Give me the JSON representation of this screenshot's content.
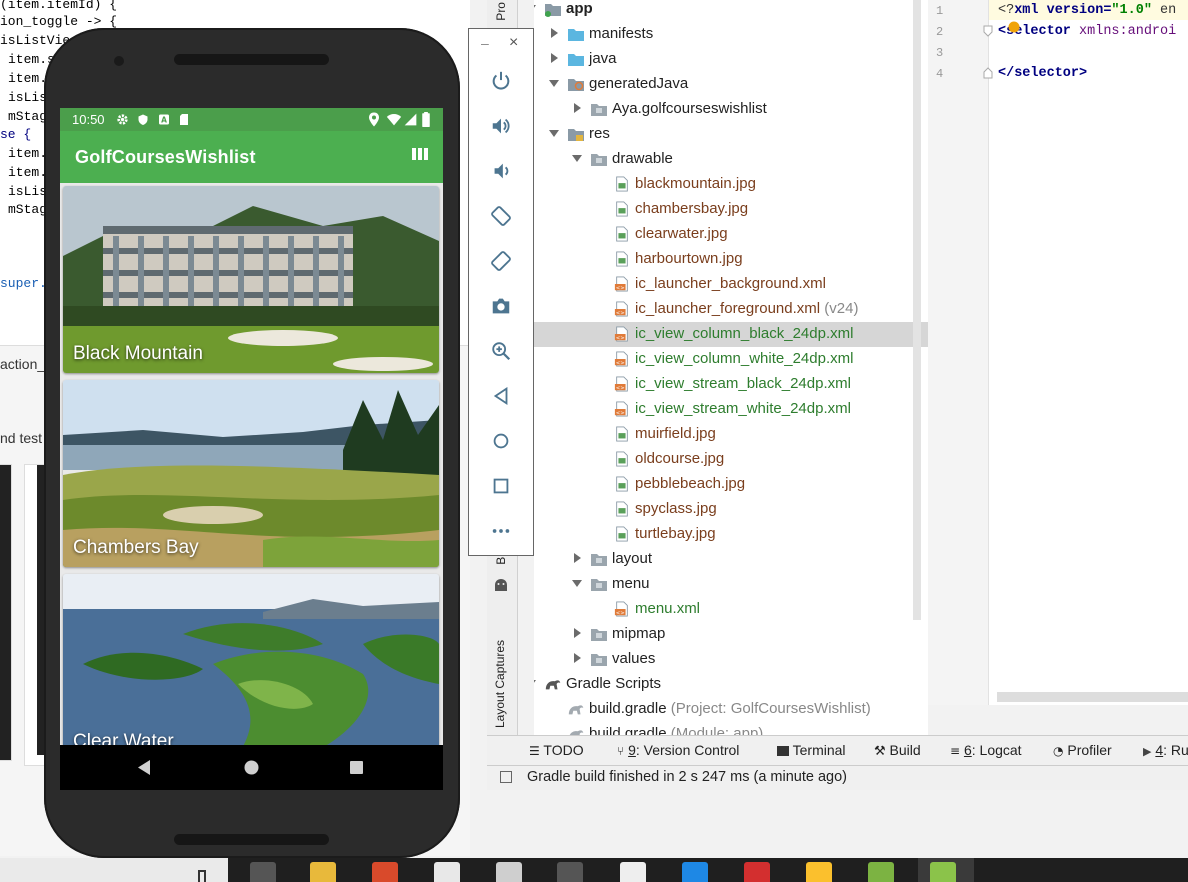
{
  "background_code": {
    "lines": [
      "(item.itemId) {",
      "ion_toggle -> {",
      "isListVie",
      "item.s",
      "item.s",
      "isLis",
      "mStag",
      "se {",
      "item.s",
      "item.s",
      "isLis",
      "mStag",
      "super.on"
    ],
    "lower_texts": [
      "action_",
      "nd test"
    ]
  },
  "emulator": {
    "status_time": "10:50",
    "app_title": "GolfCoursesWishlist",
    "view_toggle_icon": "view-column-icon",
    "courses": [
      {
        "name": "Black Mountain"
      },
      {
        "name": "Chambers Bay"
      },
      {
        "name": "Clear Water"
      }
    ],
    "nav": [
      "back-icon",
      "home-icon",
      "recents-icon"
    ]
  },
  "emulator_toolbar": {
    "minimize": "–",
    "close": "×",
    "buttons": [
      "power-icon",
      "volume-up-icon",
      "volume-down-icon",
      "rotate-left-icon",
      "rotate-right-icon",
      "camera-icon",
      "zoom-icon",
      "back-icon",
      "home-icon",
      "overview-icon",
      "more-icon"
    ]
  },
  "ide_side_strip": {
    "top_label": "Pro",
    "mid_label": "Bu",
    "bottom_label": "Layout Captures"
  },
  "project_tree": {
    "rows": [
      {
        "label": "app",
        "depth": 0,
        "expanded": true,
        "type": "module"
      },
      {
        "label": "manifests",
        "depth": 1,
        "expanded": false,
        "type": "folder"
      },
      {
        "label": "java",
        "depth": 1,
        "expanded": false,
        "type": "folder"
      },
      {
        "label": "generatedJava",
        "depth": 1,
        "expanded": true,
        "type": "folder-gen"
      },
      {
        "label": "Aya.golfcourseswishlist",
        "depth": 2,
        "expanded": false,
        "type": "package"
      },
      {
        "label": "res",
        "depth": 1,
        "expanded": true,
        "type": "folder-res"
      },
      {
        "label": "drawable",
        "depth": 2,
        "expanded": true,
        "type": "package"
      },
      {
        "label": "blackmountain.jpg",
        "depth": 3,
        "type": "image"
      },
      {
        "label": "chambersbay.jpg",
        "depth": 3,
        "type": "image"
      },
      {
        "label": "clearwater.jpg",
        "depth": 3,
        "type": "image"
      },
      {
        "label": "harbourtown.jpg",
        "depth": 3,
        "type": "image"
      },
      {
        "label": "ic_launcher_background.xml",
        "depth": 3,
        "type": "xml"
      },
      {
        "label": "ic_launcher_foreground.xml",
        "hint": "(v24)",
        "depth": 3,
        "type": "xml"
      },
      {
        "label": "ic_view_column_black_24dp.xml",
        "depth": 3,
        "type": "xml-new",
        "selected": true
      },
      {
        "label": "ic_view_column_white_24dp.xml",
        "depth": 3,
        "type": "xml-new"
      },
      {
        "label": "ic_view_stream_black_24dp.xml",
        "depth": 3,
        "type": "xml-new"
      },
      {
        "label": "ic_view_stream_white_24dp.xml",
        "depth": 3,
        "type": "xml-new"
      },
      {
        "label": "muirfield.jpg",
        "depth": 3,
        "type": "image"
      },
      {
        "label": "oldcourse.jpg",
        "depth": 3,
        "type": "image"
      },
      {
        "label": "pebblebeach.jpg",
        "depth": 3,
        "type": "image"
      },
      {
        "label": "spyclass.jpg",
        "depth": 3,
        "type": "image"
      },
      {
        "label": "turtlebay.jpg",
        "depth": 3,
        "type": "image"
      },
      {
        "label": "layout",
        "depth": 2,
        "expanded": false,
        "type": "package"
      },
      {
        "label": "menu",
        "depth": 2,
        "expanded": true,
        "type": "package"
      },
      {
        "label": "menu.xml",
        "depth": 3,
        "type": "xml-new"
      },
      {
        "label": "mipmap",
        "depth": 2,
        "expanded": false,
        "type": "package"
      },
      {
        "label": "values",
        "depth": 2,
        "expanded": false,
        "type": "package"
      },
      {
        "label": "Gradle Scripts",
        "depth": 0,
        "expanded": true,
        "type": "gradle"
      },
      {
        "label": "build.gradle",
        "hint": "(Project: GolfCoursesWishlist)",
        "depth": 1,
        "type": "gradle-file"
      },
      {
        "label": "build.gradle",
        "hint": "(Module: app)",
        "depth": 1,
        "type": "gradle-file"
      }
    ]
  },
  "editor": {
    "line_numbers": [
      "1",
      "2",
      "3",
      "4"
    ],
    "line1_prefix": "<?",
    "line1_kw": "xml version=",
    "line1_val": "\"1.0\"",
    "line1_rest": " en",
    "line2_tag": "<selector",
    "line2_attr": " xmlns:androi",
    "line4": "</selector>"
  },
  "tool_tabs": [
    {
      "icon": "todo-icon",
      "key": "",
      "label": "TODO"
    },
    {
      "icon": "version-control-icon",
      "key": "9",
      "label": ": Version Control"
    },
    {
      "icon": "terminal-icon",
      "key": "",
      "label": "Terminal"
    },
    {
      "icon": "build-icon",
      "key": "",
      "label": "Build"
    },
    {
      "icon": "logcat-icon",
      "key": "6",
      "label": ": Logcat"
    },
    {
      "icon": "profiler-icon",
      "key": "",
      "label": "Profiler"
    },
    {
      "icon": "run-icon",
      "key": "4",
      "label": ": Ru"
    }
  ],
  "status": {
    "message": "Gradle build finished in 2 s 247 ms (a minute ago)"
  },
  "colors": {
    "app_bar": "#4caf50",
    "status_bar": "#4b9e4b",
    "file_modified": "#7a3e1d",
    "file_new": "#2e7d2e"
  }
}
